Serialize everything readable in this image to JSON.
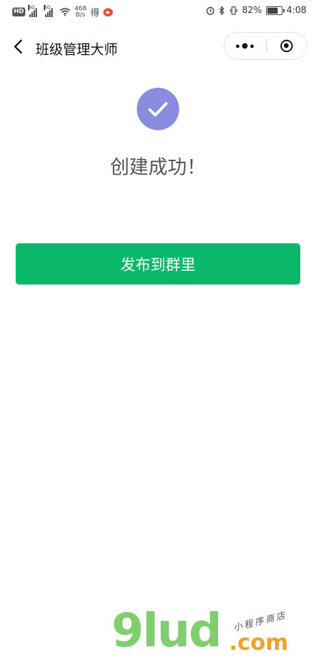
{
  "status_bar": {
    "hd": "HD",
    "signal_gen_1": "4G",
    "signal_gen_2": "4G",
    "speed_value": "468",
    "speed_unit": "B/s",
    "app_char": "得",
    "battery_percent": "82%",
    "battery_level": 0.82,
    "time": "4:08"
  },
  "nav": {
    "title": "班级管理大师"
  },
  "main": {
    "success_message": "创建成功！",
    "publish_button_label": "发布到群里"
  },
  "watermark": {
    "logo_text": "9lud",
    "dotcom_text": ".com",
    "handwritten_text": "小程序商店"
  },
  "colors": {
    "success_icon_bg": "#8a8ddf",
    "primary_button": "#0bb768"
  }
}
